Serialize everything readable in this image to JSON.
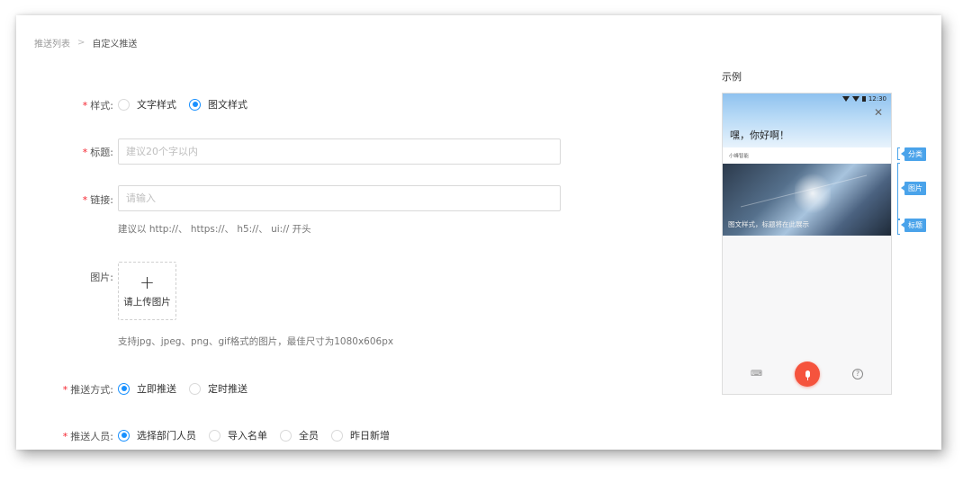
{
  "breadcrumb": {
    "parent": "推送列表",
    "separator": ">",
    "current": "自定义推送"
  },
  "form": {
    "style": {
      "label": "样式:",
      "options": [
        "文字样式",
        "图文样式"
      ],
      "selected": "图文样式"
    },
    "title": {
      "label": "标题:",
      "placeholder": "建议20个字以内",
      "value": ""
    },
    "link": {
      "label": "链接:",
      "placeholder": "请输入",
      "value": "",
      "hint": "建议以 http://、 https://、 h5://、 ui:// 开头"
    },
    "image": {
      "label": "图片:",
      "upload_plus": "+",
      "upload_label": "请上传图片",
      "hint": "支持jpg、jpeg、png、gif格式的图片，最佳尺寸为1080x606px"
    },
    "push_method": {
      "label": "推送方式:",
      "options": [
        "立即推送",
        "定时推送"
      ],
      "selected": "立即推送"
    },
    "push_target": {
      "label": "推送人员:",
      "options": [
        "选择部门人员",
        "导入名单",
        "全员",
        "昨日新增"
      ],
      "selected": "选择部门人员"
    },
    "required_mark": "*"
  },
  "preview": {
    "title": "示例",
    "status_time": "12:30",
    "greeting": "嘿，你好啊！",
    "close_glyph": "✕",
    "source": "小峰智能",
    "caption": "图文样式，标题将在此展示",
    "keyboard_glyph": "⌨",
    "help_glyph": "?",
    "tags": [
      "分类",
      "图片",
      "标题"
    ]
  },
  "colors": {
    "primary": "#1890ff",
    "required": "#f5222d",
    "tag": "#4aa3ea",
    "mic": "#f5533d"
  }
}
